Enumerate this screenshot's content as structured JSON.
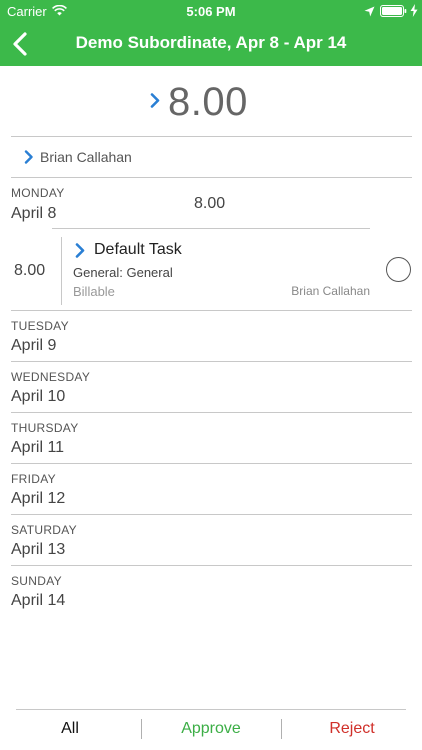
{
  "status_bar": {
    "carrier": "Carrier",
    "time": "5:06 PM"
  },
  "nav": {
    "title": "Demo Subordinate, Apr 8 - Apr 14"
  },
  "summary": {
    "total_hours": "8.00",
    "user_name": "Brian Callahan"
  },
  "days": [
    {
      "day": "MONDAY",
      "date": "April 8",
      "total": "8.00"
    },
    {
      "day": "TUESDAY",
      "date": "April 9"
    },
    {
      "day": "WEDNESDAY",
      "date": "April 10"
    },
    {
      "day": "THURSDAY",
      "date": "April 11"
    },
    {
      "day": "FRIDAY",
      "date": "April 12"
    },
    {
      "day": "SATURDAY",
      "date": "April 13"
    },
    {
      "day": "SUNDAY",
      "date": "April 14"
    }
  ],
  "entry": {
    "hours": "8.00",
    "task": "Default Task",
    "project": "General: General",
    "billable": "Billable",
    "user": "Brian Callahan"
  },
  "tabs": {
    "all": "All",
    "approve": "Approve",
    "reject": "Reject"
  },
  "colors": {
    "header_green": "#3cb94a",
    "accent_blue": "#2a7fd4",
    "approve_green": "#3cae46",
    "reject_red": "#d0302a"
  }
}
